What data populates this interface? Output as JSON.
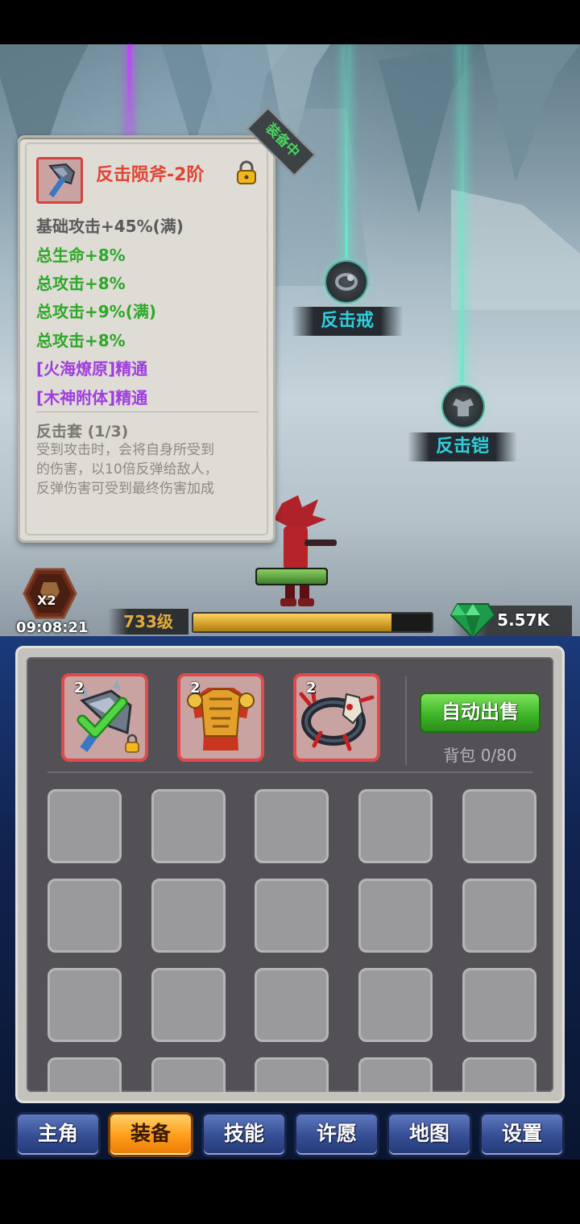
{
  "scene": {
    "drops": [
      {
        "label": "反击戒",
        "icon": "ring-icon"
      },
      {
        "label": "反击铠",
        "icon": "armor-icon"
      }
    ],
    "boost_label": "X2",
    "timer": "09:08:21",
    "level": "733级",
    "exp_fraction": 0.83,
    "gems": "5.57K"
  },
  "tooltip": {
    "equipped_tag": "装备中",
    "name": "反击陨斧-2阶",
    "base_stat": "基础攻击+45%(满)",
    "stats_green": [
      "总生命+8%",
      "总攻击+8%",
      "总攻击+9%(满)",
      "总攻击+8%"
    ],
    "stats_purple": [
      "[火海燎原]精通",
      "[木神附体]精通"
    ],
    "set_title": "反击套 (1/3)",
    "set_desc": "受到攻击时，会将自身所受到\n的伤害，以10倍反弹给敌人，\n反弹伤害可受到最终伤害加成"
  },
  "equipment": {
    "slots": [
      {
        "level": "2",
        "icon": "axe-icon",
        "equipped": true,
        "locked": true
      },
      {
        "level": "2",
        "icon": "armor-icon",
        "equipped": false,
        "locked": false
      },
      {
        "level": "2",
        "icon": "ring-icon",
        "equipped": false,
        "locked": false
      }
    ],
    "auto_sell_label": "自动出售",
    "bag_label": "背包 0/80"
  },
  "tabs": [
    "主角",
    "装备",
    "技能",
    "许愿",
    "地图",
    "设置"
  ],
  "active_tab": 1,
  "colors": {
    "item_name": "#e24434",
    "stat_green": "#2ea82a",
    "stat_purple": "#a03de0",
    "slot_border_red": "#e14a4a",
    "drop_label_cyan": "#2fd0dd",
    "level_gold": "#e2ab3c"
  }
}
